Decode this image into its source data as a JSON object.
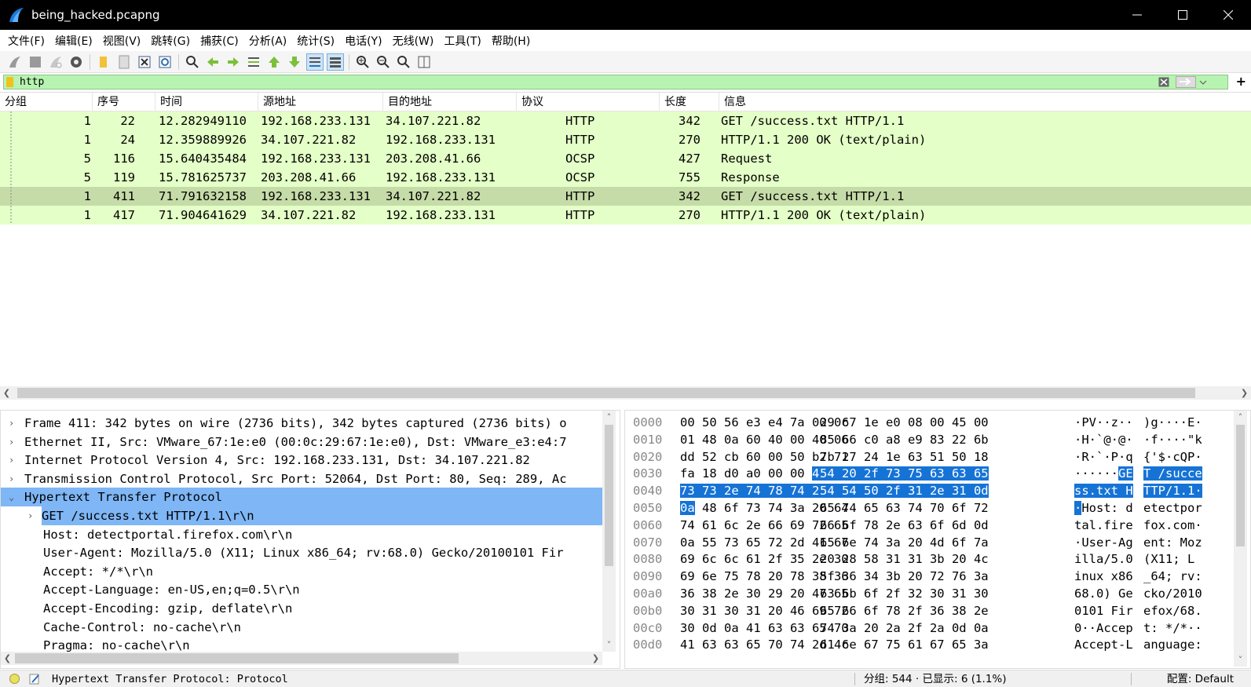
{
  "window": {
    "title": "being_hacked.pcapng"
  },
  "menu": [
    "文件(F)",
    "编辑(E)",
    "视图(V)",
    "跳转(G)",
    "捕获(C)",
    "分析(A)",
    "统计(S)",
    "电话(Y)",
    "无线(W)",
    "工具(T)",
    "帮助(H)"
  ],
  "filter": {
    "value": "http"
  },
  "packet_list": {
    "columns": [
      "分组",
      "序号",
      "时间",
      "源地址",
      "目的地址",
      "协议",
      "长度",
      "信息"
    ],
    "rows": [
      {
        "group": "1",
        "no": "22",
        "time": "12.282949110",
        "src": "192.168.233.131",
        "dst": "34.107.221.82",
        "proto": "HTTP",
        "len": "342",
        "info": "GET /success.txt HTTP/1.1"
      },
      {
        "group": "1",
        "no": "24",
        "time": "12.359889926",
        "src": "34.107.221.82",
        "dst": "192.168.233.131",
        "proto": "HTTP",
        "len": "270",
        "info": "HTTP/1.1 200 OK  (text/plain)"
      },
      {
        "group": "5",
        "no": "116",
        "time": "15.640435484",
        "src": "192.168.233.131",
        "dst": "203.208.41.66",
        "proto": "OCSP",
        "len": "427",
        "info": "Request"
      },
      {
        "group": "5",
        "no": "119",
        "time": "15.781625737",
        "src": "203.208.41.66",
        "dst": "192.168.233.131",
        "proto": "OCSP",
        "len": "755",
        "info": "Response"
      },
      {
        "group": "1",
        "no": "411",
        "time": "71.791632158",
        "src": "192.168.233.131",
        "dst": "34.107.221.82",
        "proto": "HTTP",
        "len": "342",
        "info": "GET /success.txt HTTP/1.1"
      },
      {
        "group": "1",
        "no": "417",
        "time": "71.904641629",
        "src": "34.107.221.82",
        "dst": "192.168.233.131",
        "proto": "HTTP",
        "len": "270",
        "info": "HTTP/1.1 200 OK  (text/plain)"
      }
    ],
    "selected_index": 4
  },
  "details": {
    "tree": [
      {
        "expander": "›",
        "text": "Frame 411: 342 bytes on wire (2736 bits), 342 bytes captured (2736 bits) o"
      },
      {
        "expander": "›",
        "text": "Ethernet II, Src: VMware_67:1e:e0 (00:0c:29:67:1e:e0), Dst: VMware_e3:e4:7"
      },
      {
        "expander": "›",
        "text": "Internet Protocol Version 4, Src: 192.168.233.131, Dst: 34.107.221.82"
      },
      {
        "expander": "›",
        "text": "Transmission Control Protocol, Src Port: 52064, Dst Port: 80, Seq: 289, Ac"
      },
      {
        "expander": "⌄",
        "text": "Hypertext Transfer Protocol"
      },
      {
        "expander": "›",
        "text": "GET /success.txt HTTP/1.1\\r\\n"
      },
      {
        "expander": "",
        "text": "Host: detectportal.firefox.com\\r\\n"
      },
      {
        "expander": "",
        "text": "User-Agent: Mozilla/5.0 (X11; Linux x86_64; rv:68.0) Gecko/20100101 Fir"
      },
      {
        "expander": "",
        "text": "Accept: */*\\r\\n"
      },
      {
        "expander": "",
        "text": "Accept-Language: en-US,en;q=0.5\\r\\n"
      },
      {
        "expander": "",
        "text": "Accept-Encoding: gzip, deflate\\r\\n"
      },
      {
        "expander": "",
        "text": "Cache-Control: no-cache\\r\\n"
      },
      {
        "expander": "",
        "text": "Pragma: no-cache\\r\\n"
      }
    ]
  },
  "bytes": {
    "rows": [
      {
        "offset": "0000",
        "hex_a": "00 50 56 e3 e4 7a 00 0c",
        "hex_b": "29 67 1e e0 08 00 45 00",
        "ascii_a": "·PV··z··",
        "ascii_b": ")g····E·"
      },
      {
        "offset": "0010",
        "hex_a": "01 48 0a 60 40 00 40 06",
        "hex_b": "85 66 c0 a8 e9 83 22 6b",
        "ascii_a": "·H·`@·@·",
        "ascii_b": "·f····\"k"
      },
      {
        "offset": "0020",
        "hex_a": "dd 52 cb 60 00 50 b2 71",
        "hex_b": "7b 27 24 1e 63 51 50 18",
        "ascii_a": "·R·`·P·q",
        "ascii_b": "{'$·cQP·"
      },
      {
        "offset": "0030",
        "hex_a": "fa 18 d0 a0 00 00",
        "hex_a_hl": "47 45",
        "hex_b": "",
        "hex_b_hl": "54 20 2f 73 75 63 63 65",
        "ascii_a": "······",
        "ascii_a_hl": "GE",
        "ascii_b": "",
        "ascii_b_hl": "T /succe"
      },
      {
        "offset": "0040",
        "hex_a": "",
        "hex_a_hl": "73 73 2e 74 78 74 20 48",
        "hex_b": "",
        "hex_b_hl": "54 54 50 2f 31 2e 31 0d",
        "ascii_a": "",
        "ascii_a_hl": "ss.txt H",
        "ascii_b": "",
        "ascii_b_hl": "TTP/1.1·"
      },
      {
        "offset": "0050",
        "hex_a_hl": "0a",
        "hex_a": " 48 6f 73 74 3a 20 64",
        "hex_b": "65 74 65 63 74 70 6f 72",
        "ascii_a_hl": "·",
        "ascii_a": "Host: d",
        "ascii_b": "etectpor"
      },
      {
        "offset": "0060",
        "hex_a": "74 61 6c 2e 66 69 72 65",
        "hex_b": "66 6f 78 2e 63 6f 6d 0d",
        "ascii_a": "tal.fire",
        "ascii_b": "fox.com·"
      },
      {
        "offset": "0070",
        "hex_a": "0a 55 73 65 72 2d 41 67",
        "hex_b": "65 6e 74 3a 20 4d 6f 7a",
        "ascii_a": "·User-Ag",
        "ascii_b": "ent: Moz"
      },
      {
        "offset": "0080",
        "hex_a": "69 6c 6c 61 2f 35 2e 30",
        "hex_b": "20 28 58 31 31 3b 20 4c",
        "ascii_a": "illa/5.0",
        "ascii_b": " (X11; L"
      },
      {
        "offset": "0090",
        "hex_a": "69 6e 75 78 20 78 38 36",
        "hex_b": "5f 36 34 3b 20 72 76 3a",
        "ascii_a": "inux x86",
        "ascii_b": "_64; rv:"
      },
      {
        "offset": "00a0",
        "hex_a": "36 38 2e 30 29 20 47 65",
        "hex_b": "63 6b 6f 2f 32 30 31 30",
        "ascii_a": "68.0) Ge",
        "ascii_b": "cko/2010"
      },
      {
        "offset": "00b0",
        "hex_a": "30 31 30 31 20 46 69 72",
        "hex_b": "65 66 6f 78 2f 36 38 2e",
        "ascii_a": "0101 Fir",
        "ascii_b": "efox/68."
      },
      {
        "offset": "00c0",
        "hex_a": "30 0d 0a 41 63 63 65 70",
        "hex_b": "74 3a 20 2a 2f 2a 0d 0a",
        "ascii_a": "0··Accep",
        "ascii_b": "t: */*··"
      },
      {
        "offset": "00d0",
        "hex_a": "41 63 63 65 70 74 2d 4c",
        "hex_b": "61 6e 67 75 61 67 65 3a",
        "ascii_a": "Accept-L",
        "ascii_b": "anguage:"
      }
    ]
  },
  "status": {
    "text": "Hypertext Transfer Protocol: Protocol",
    "packets": "分组: 544 · 已显示: 6 (1.1%)",
    "profile": "配置: Default"
  },
  "colors": {
    "row_http": "#e4ffc7",
    "row_selected": "#c6dca8",
    "filter_ok": "#b7f4b1",
    "tree_selected": "#7fb6f5",
    "byte_highlight": "#1673d6"
  }
}
